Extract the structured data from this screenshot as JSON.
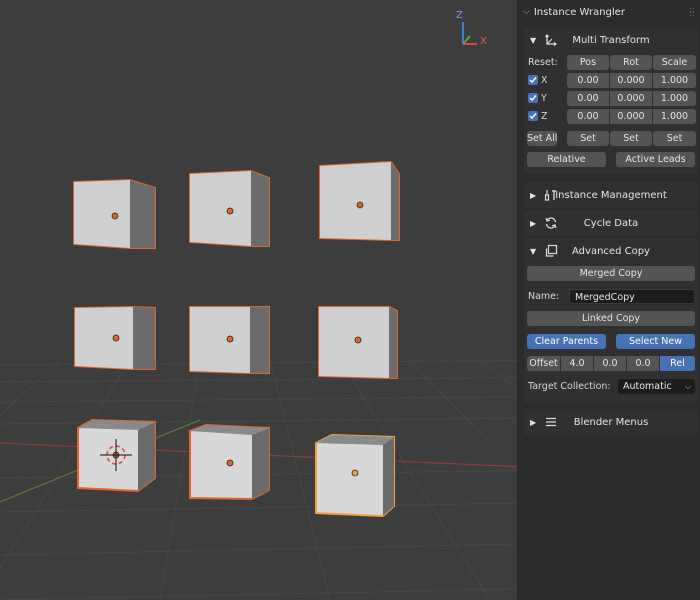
{
  "gizmo": {
    "z": "Z",
    "x": "X"
  },
  "addon": {
    "title": "Instance Wrangler",
    "collapse_icon": "chevron-down-icon"
  },
  "multi_transform": {
    "title": "Multi Transform",
    "icon": "transform-axes-icon",
    "reset_label": "Reset:",
    "reset_buttons": [
      "Pos",
      "Rot",
      "Scale"
    ],
    "rows": [
      {
        "axis": "X",
        "pos": "0.00",
        "rot": "0.000",
        "scale": "1.000",
        "checked": true
      },
      {
        "axis": "Y",
        "pos": "0.00",
        "rot": "0.000",
        "scale": "1.000",
        "checked": true
      },
      {
        "axis": "Z",
        "pos": "0.00",
        "rot": "0.000",
        "scale": "1.000",
        "checked": true
      }
    ],
    "set_all_label": "Set All",
    "set_labels": [
      "Set",
      "Set",
      "Set"
    ],
    "relative_label": "Relative",
    "active_leads_label": "Active Leads"
  },
  "instance_management": {
    "title": "Instance Management",
    "icon": "tools-icon"
  },
  "cycle_data": {
    "title": "Cycle Data",
    "icon": "cycle-icon"
  },
  "advanced_copy": {
    "title": "Advanced Copy",
    "icon": "duplicate-icon",
    "merged_copy_label": "Merged Copy",
    "name_label": "Name:",
    "name_value": "MergedCopy",
    "linked_copy_label": "Linked Copy",
    "clear_parents_label": "Clear Parents",
    "select_new_label": "Select New",
    "offset_label": "Offset",
    "offset_values": [
      "4.0",
      "0.0",
      "0.0"
    ],
    "rel_label": "Rel",
    "target_collection_label": "Target Collection:",
    "target_collection_value": "Automatic"
  },
  "blender_menus": {
    "title": "Blender Menus",
    "icon": "menu-lines-icon"
  },
  "colors": {
    "accent": "#4772b3",
    "selection": "#e0642b",
    "active": "#f3a040",
    "viewport_bg": "#3d3d3d",
    "panel_bg": "#303030"
  }
}
